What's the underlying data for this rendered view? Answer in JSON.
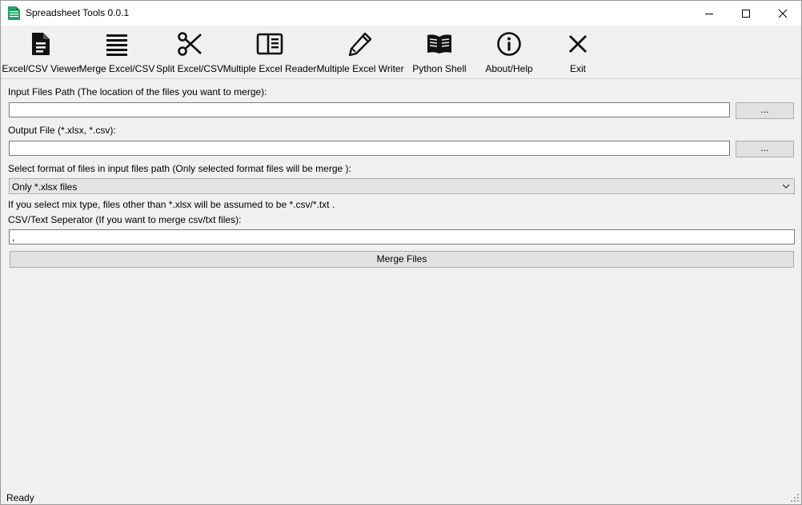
{
  "window": {
    "title": "Spreadsheet Tools 0.0.1",
    "controls": [
      "minimize-icon",
      "maximize-icon",
      "close-icon"
    ]
  },
  "toolbar": {
    "items": [
      {
        "label": "Excel/CSV Viewer",
        "icon": "document-icon"
      },
      {
        "label": "Merge Excel/CSV",
        "icon": "stacked-lines-icon"
      },
      {
        "label": "Split Excel/CSV",
        "icon": "scissors-icon"
      },
      {
        "label": "Multiple Excel Reader",
        "icon": "reader-panel-icon"
      },
      {
        "label": "Multiple Excel Writer",
        "icon": "pencil-icon"
      },
      {
        "label": "Python Shell",
        "icon": "open-book-icon"
      },
      {
        "label": "About/Help",
        "icon": "info-icon"
      },
      {
        "label": "Exit",
        "icon": "x-icon"
      }
    ]
  },
  "form": {
    "input_path_label": "Input Files Path (The location of the files you want to merge):",
    "input_path_value": "",
    "browse_label": "...",
    "output_file_label": "Output File (*.xlsx, *.csv):",
    "output_file_value": "",
    "format_label": "Select format of files in input files path (Only selected format files will be merge ):",
    "format_selected": "Only *.xlsx files",
    "mix_note": "If you select mix type, files other than *.xlsx will be assumed to be *.csv/*.txt .",
    "separator_label": "CSV/Text Seperator (If you want to merge csv/txt files):",
    "separator_value": ",",
    "merge_button": "Merge Files"
  },
  "statusbar": {
    "text": "Ready"
  }
}
